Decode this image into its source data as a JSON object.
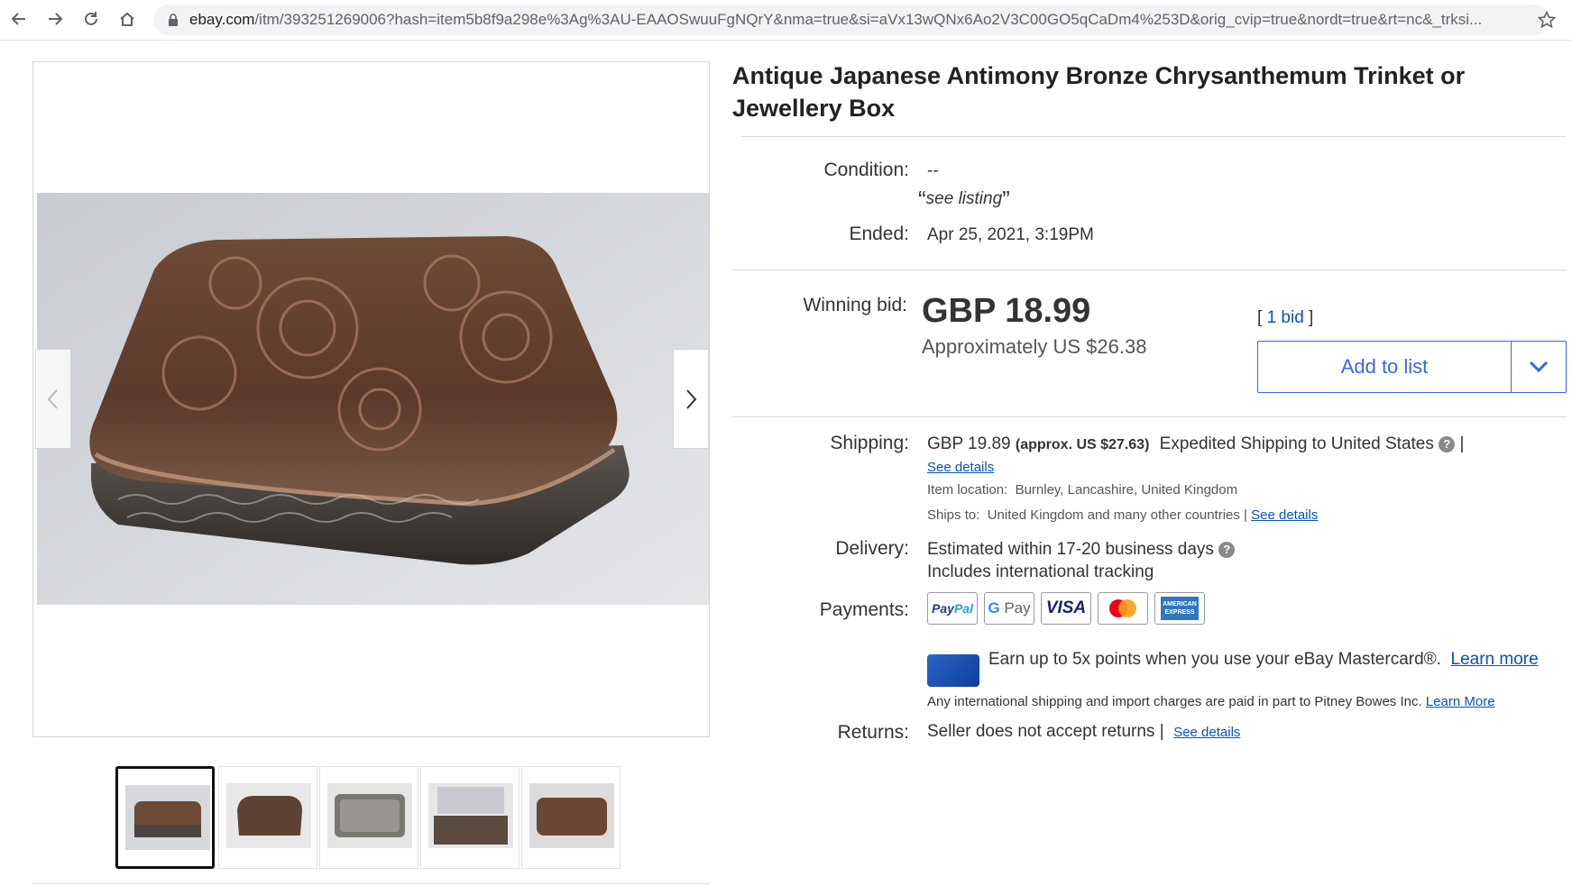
{
  "browser": {
    "url_host": "ebay.com",
    "url_path": "/itm/393251269006?hash=item5b8f9a298e%3Ag%3AU-EAAOSwuuFgNQrY&nma=true&si=aVx13wQNx6Ao2V3C00GO5qCaDm4%253D&orig_cvip=true&nordt=true&rt=nc&_trksi..."
  },
  "listing": {
    "title": "Antique Japanese Antimony Bronze Chrysanthemum Trinket or Jewellery Box",
    "condition_label": "Condition:",
    "condition_value": "--",
    "condition_note": "see listing",
    "ended_label": "Ended:",
    "ended_value": "Apr 25, 2021, 3:19PM",
    "winning_bid_label": "Winning bid:",
    "price": "GBP 18.99",
    "approx_price": "Approximately US $26.38",
    "bid_count": "1 bid",
    "add_to_list": "Add to list"
  },
  "shipping": {
    "label": "Shipping:",
    "cost": "GBP 19.89",
    "approx": "(approx. US $27.63)",
    "service": "Expedited Shipping to United States",
    "see_details": "See details",
    "location_label": "Item location:",
    "location_value": "Burnley, Lancashire, United Kingdom",
    "ships_to_label": "Ships to:",
    "ships_to_value": "United Kingdom and many other countries |",
    "ships_see_details": "See details"
  },
  "delivery": {
    "label": "Delivery:",
    "line1": "Estimated within 17-20 business days",
    "line2": "Includes international tracking"
  },
  "payments": {
    "label": "Payments:",
    "methods": [
      "PayPal",
      "G Pay",
      "VISA",
      "Mastercard",
      "American Express"
    ],
    "promo_text": "Earn up to 5x points when you use your eBay Mastercard®.",
    "promo_link": "Learn",
    "promo_link2": "more",
    "intl_note": "Any international shipping and import charges are paid in part to Pitney Bowes Inc.",
    "intl_link": "Learn More"
  },
  "returns": {
    "label": "Returns:",
    "value": "Seller does not accept returns |",
    "see_details": "See details"
  },
  "colors": {
    "link": "#0654ba",
    "button": "#3665f3"
  }
}
